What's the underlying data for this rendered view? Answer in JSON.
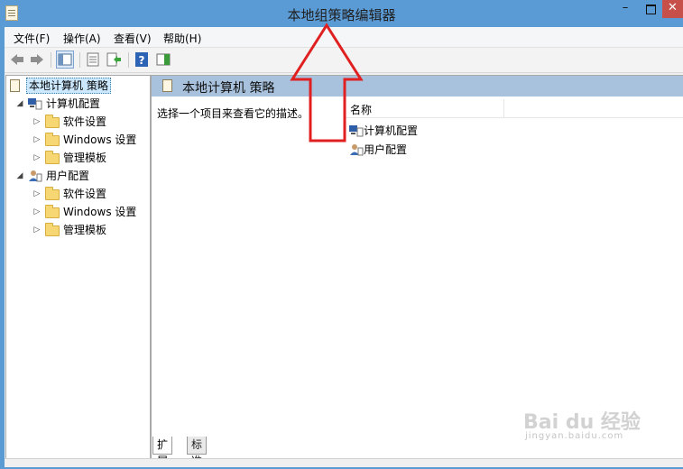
{
  "window": {
    "title": "本地组策略编辑器",
    "minimize": "–",
    "close": "✕"
  },
  "menu": [
    "文件(F)",
    "操作(A)",
    "查看(V)",
    "帮助(H)"
  ],
  "toolbar": {
    "icons": [
      "back-arrow-icon",
      "forward-arrow-icon",
      "show-hide-tree-icon",
      "properties-icon",
      "export-list-icon",
      "help-icon",
      "show-action-pane-icon"
    ]
  },
  "tree": {
    "root": "本地计算机 策略",
    "computer": {
      "label": "计算机配置",
      "children": [
        "软件设置",
        "Windows 设置",
        "管理模板"
      ]
    },
    "user": {
      "label": "用户配置",
      "children": [
        "软件设置",
        "Windows 设置",
        "管理模板"
      ]
    }
  },
  "right": {
    "header_title": "本地计算机 策略",
    "description": "选择一个项目来查看它的描述。",
    "column_name": "名称",
    "items": [
      "计算机配置",
      "用户配置"
    ]
  },
  "tabs": [
    "扩展",
    "标准"
  ],
  "watermark": {
    "main": "Bai du 经验",
    "sub": "jingyan.baidu.com"
  },
  "colors": {
    "titlebar": "#5b9bd5",
    "header_band": "#a8c1dc",
    "annotation": "#e02020",
    "close_button": "#c7504a"
  }
}
